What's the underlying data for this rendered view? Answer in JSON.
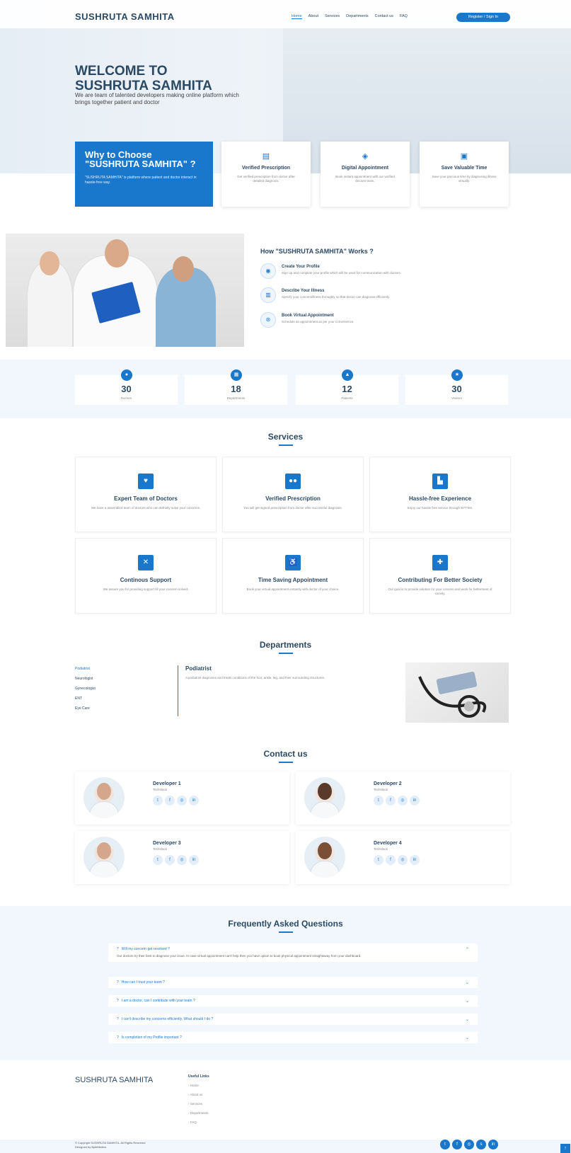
{
  "header": {
    "logo": "SUSHRUTA SAMHITA",
    "nav": [
      "Home",
      "About",
      "Services",
      "Departments",
      "Contact us",
      "FAQ"
    ],
    "register_button": "Register / Sign In"
  },
  "hero": {
    "title_line1": "WELCOME TO",
    "title_line2": "SUSHRUTA SAMHITA",
    "subtitle": "We are team of talented developers making online platform which brings together patient and doctor"
  },
  "why": {
    "title": "Why to Choose \"SUSHRUTA SAMHITA\" ?",
    "text": "\"SUSHRUTA SAMHITA\" is platform where patient and doctor interact in hassle-free way."
  },
  "features": [
    {
      "icon": "clipboard-icon",
      "title": "Verified Prescription",
      "text": "Get verified prescription from doctor after detailed diagnosis."
    },
    {
      "icon": "gem-icon",
      "title": "Digital Appointment",
      "text": "Book instant appointment with our verified doctors team."
    },
    {
      "icon": "images-icon",
      "title": "Save Valuable Time",
      "text": "Save your precious time by diagnosing illness virtually."
    }
  ],
  "how": {
    "title": "How \"SUSHRUTA SAMHITA\" Works ?",
    "steps": [
      {
        "icon": "fingerprint-icon",
        "title": "Create Your Profile",
        "text": "Sign up and complete your profile which will be used for communication with doctors."
      },
      {
        "icon": "gift-icon",
        "title": "Describe Your Illness",
        "text": "Specify your concern/illness throughly so that doctor can diagnose efficiently."
      },
      {
        "icon": "atom-icon",
        "title": "Book Virtual Appointment",
        "text": "Schedule an appointment as per your convenience."
      }
    ]
  },
  "counts": [
    {
      "icon": "user-md-icon",
      "value": "30",
      "label": "Doctors"
    },
    {
      "icon": "hospital-icon",
      "value": "18",
      "label": "Departments"
    },
    {
      "icon": "flask-icon",
      "value": "12",
      "label": "Patients"
    },
    {
      "icon": "award-icon",
      "value": "30",
      "label": "Visitors"
    }
  ],
  "services": {
    "title": "Services",
    "items": [
      {
        "icon": "heartbeat-icon",
        "title": "Expert Team of Doctors",
        "text": "We have a assembled team of doctors who can defnetly solve your concerns."
      },
      {
        "icon": "pills-icon",
        "title": "Verified Prescription",
        "text": "You will get signed prescription from doctor after successful diagnosis."
      },
      {
        "icon": "hospital-user-icon",
        "title": "Hassle-free Experience",
        "text": "Enjoy our hassle free service through BYTTes."
      },
      {
        "icon": "dna-icon",
        "title": "Continous Support",
        "text": "We assure you for providing support till your concern solved."
      },
      {
        "icon": "wheelchair-icon",
        "title": "Time Saving Appointment",
        "text": "Book your virtual appointment instantly with doctor of your choice."
      },
      {
        "icon": "notes-medical-icon",
        "title": "Contributing For Better Society",
        "text": "Our goal is to provide solution for your concern and work for betterment of society."
      }
    ]
  },
  "departments": {
    "title": "Departments",
    "list": [
      "Podiatrist",
      "Neurologist",
      "Gynecologist",
      "ENT",
      "Eye Care"
    ],
    "active_name": "Podiatrist",
    "active_desc": "A podiatrist diagnoses and treats conditions of the foot, ankle, leg, and their surrounding structures."
  },
  "contact": {
    "title": "Contact us",
    "developers": [
      {
        "name": "Developer 1",
        "role": "Techstack"
      },
      {
        "name": "Developer 2",
        "role": "Techstack"
      },
      {
        "name": "Developer 3",
        "role": "Techstack"
      },
      {
        "name": "Developer 4",
        "role": "Techstack"
      }
    ]
  },
  "faq": {
    "title": "Frequently Asked Questions",
    "items": [
      {
        "q": "Will my concern get resolved ?",
        "a": "Our doctors try their best to diagnose your issue. In case virtual appointment can't help then you have option to book physical appointment straightaway from your dashboard."
      },
      {
        "q": "How can I trust your team ?",
        "a": ""
      },
      {
        "q": "I am a doctor, can I contribute with your team ?",
        "a": ""
      },
      {
        "q": "I can't describe my concerns efficiently. What should I do ?",
        "a": ""
      },
      {
        "q": "Is completion of my Profile important ?",
        "a": ""
      }
    ]
  },
  "footer": {
    "logo": "SUSHRUTA SAMHITA",
    "links_title": "Useful Links",
    "links": [
      "Home",
      "About us",
      "Services",
      "Departments",
      "FAQ"
    ],
    "copyright": "© Copyright SUSHRUTA SAMHITA. All Rights Reserved",
    "designed": "Designed by ByteMedics"
  },
  "colors": {
    "accent": "#1977cc",
    "heading": "#2c4964",
    "section_bg": "#f1f7fd"
  }
}
